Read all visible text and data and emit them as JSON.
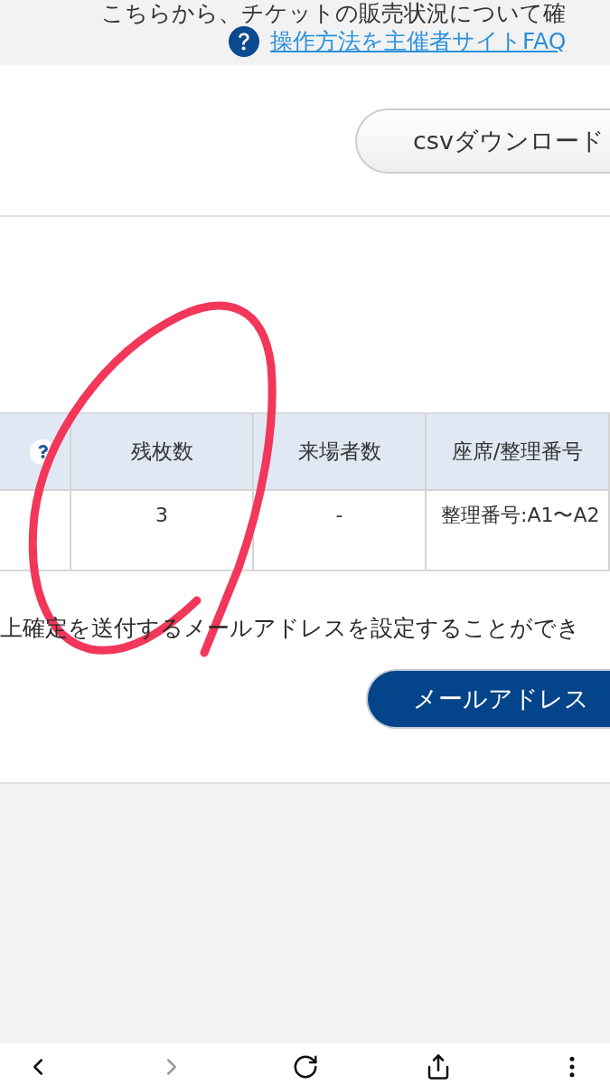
{
  "info_bar": {
    "notice": "こちらから、チケットの販売状況について確",
    "help_link": "操作方法を主催者サイトFAQ"
  },
  "csv_button": "csvダウンロード",
  "table": {
    "columns": [
      {
        "kind": "help"
      },
      {
        "kind": "text",
        "label": "残枚数"
      },
      {
        "kind": "text",
        "label": "来場者数"
      },
      {
        "kind": "text",
        "label": "座席/整理番号"
      }
    ],
    "rows": [
      [
        null,
        "3",
        "-",
        "整理番号:A1〜A2"
      ]
    ]
  },
  "mail_note": "上確定を送付するメールアドレスを設定することができ",
  "mail_button": "メールアドレス",
  "markup": [
    {
      "kind": "loop"
    }
  ],
  "toolbar": {
    "buttons": [
      {
        "kind": "back",
        "disabled": false
      },
      {
        "kind": "forward",
        "disabled": true
      },
      {
        "kind": "reload",
        "disabled": false
      },
      {
        "kind": "share",
        "disabled": false
      },
      {
        "kind": "more",
        "disabled": false
      }
    ]
  }
}
